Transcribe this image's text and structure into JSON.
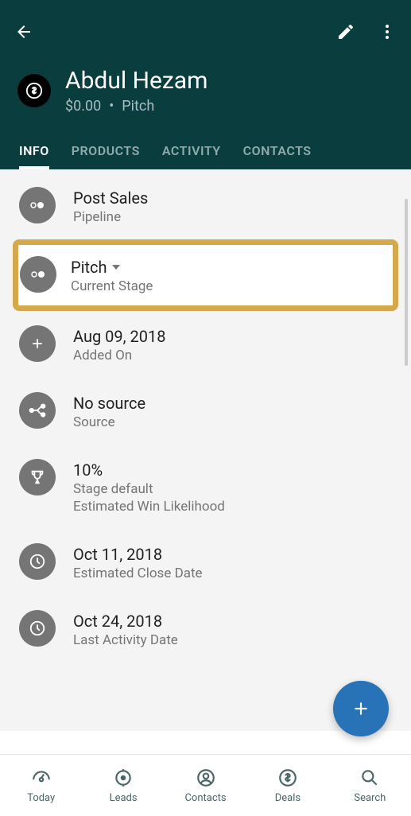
{
  "header": {
    "title": "Abdul Hezam",
    "amount": "$0.00",
    "stage": "Pitch"
  },
  "tabs": [
    {
      "label": "INFO",
      "active": true
    },
    {
      "label": "PRODUCTS",
      "active": false
    },
    {
      "label": "ACTIVITY",
      "active": false
    },
    {
      "label": "CONTACTS",
      "active": false
    }
  ],
  "info": {
    "pipeline": {
      "value": "Post Sales",
      "label": "Pipeline"
    },
    "current_stage": {
      "value": "Pitch",
      "label": "Current Stage"
    },
    "added_on": {
      "value": "Aug 09, 2018",
      "label": "Added On"
    },
    "source": {
      "value": "No source",
      "label": "Source"
    },
    "win_likelihood": {
      "value": "10%",
      "sublabel": "Stage default",
      "label": "Estimated Win Likelihood"
    },
    "close_date": {
      "value": "Oct 11, 2018",
      "label": "Estimated Close Date"
    },
    "last_activity": {
      "value": "Oct 24, 2018",
      "label": "Last Activity Date"
    }
  },
  "bottom_nav": [
    {
      "label": "Today"
    },
    {
      "label": "Leads"
    },
    {
      "label": "Contacts"
    },
    {
      "label": "Deals"
    },
    {
      "label": "Search"
    }
  ]
}
